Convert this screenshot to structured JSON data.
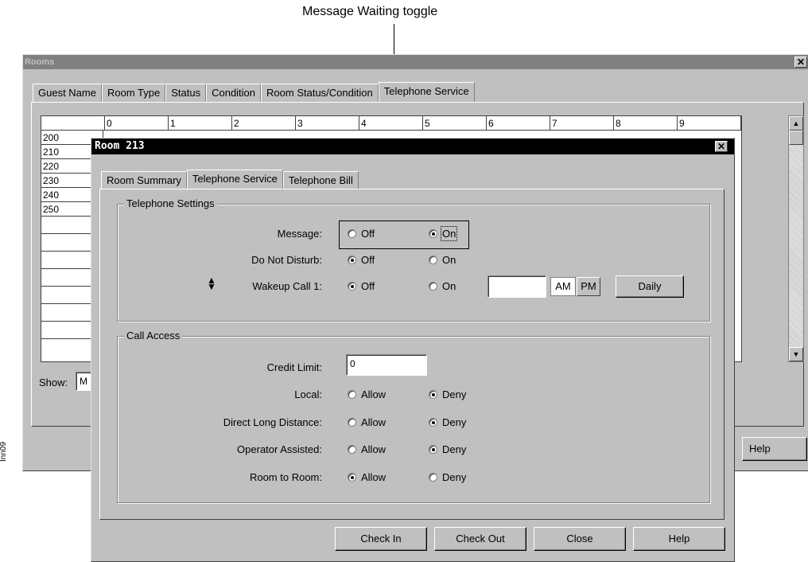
{
  "callout": {
    "text": "Message Waiting toggle"
  },
  "side_label": "Inn09",
  "rooms_window": {
    "title": "Rooms",
    "tabs": [
      "Guest Name",
      "Room Type",
      "Status",
      "Condition",
      "Room Status/Condition",
      "Telephone Service"
    ],
    "grid": {
      "columns": [
        "0",
        "1",
        "2",
        "3",
        "4",
        "5",
        "6",
        "7",
        "8",
        "9"
      ],
      "rows": [
        "200",
        "210",
        "220",
        "230",
        "240",
        "250",
        "",
        "",
        "",
        "",
        "",
        "",
        ""
      ]
    },
    "show_label": "Show:",
    "show_value": "M",
    "help_button": "Help"
  },
  "dialog": {
    "title": "Room 213",
    "tabs": [
      "Room Summary",
      "Telephone Service",
      "Telephone Bill"
    ],
    "telephone_settings": {
      "legend": "Telephone Settings",
      "message": {
        "label": "Message:",
        "off": "Off",
        "on": "On",
        "selected": "on"
      },
      "do_not_disturb": {
        "label": "Do Not Disturb:",
        "off": "Off",
        "on": "On",
        "selected": "off"
      },
      "wakeup": {
        "label": "Wakeup Call 1:",
        "off": "Off",
        "on": "On",
        "selected": "off",
        "time_value": "",
        "am": "AM",
        "pm": "PM",
        "daily": "Daily"
      }
    },
    "call_access": {
      "legend": "Call Access",
      "credit_limit": {
        "label": "Credit Limit:",
        "value": "0"
      },
      "local": {
        "label": "Local:",
        "allow": "Allow",
        "deny": "Deny",
        "selected": "deny"
      },
      "direct_long_distance": {
        "label": "Direct Long Distance:",
        "allow": "Allow",
        "deny": "Deny",
        "selected": "deny"
      },
      "operator_assisted": {
        "label": "Operator Assisted:",
        "allow": "Allow",
        "deny": "Deny",
        "selected": "deny"
      },
      "room_to_room": {
        "label": "Room to Room:",
        "allow": "Allow",
        "deny": "Deny",
        "selected": "allow"
      }
    },
    "buttons": {
      "check_in": "Check In",
      "check_out": "Check Out",
      "close": "Close",
      "help": "Help"
    }
  }
}
